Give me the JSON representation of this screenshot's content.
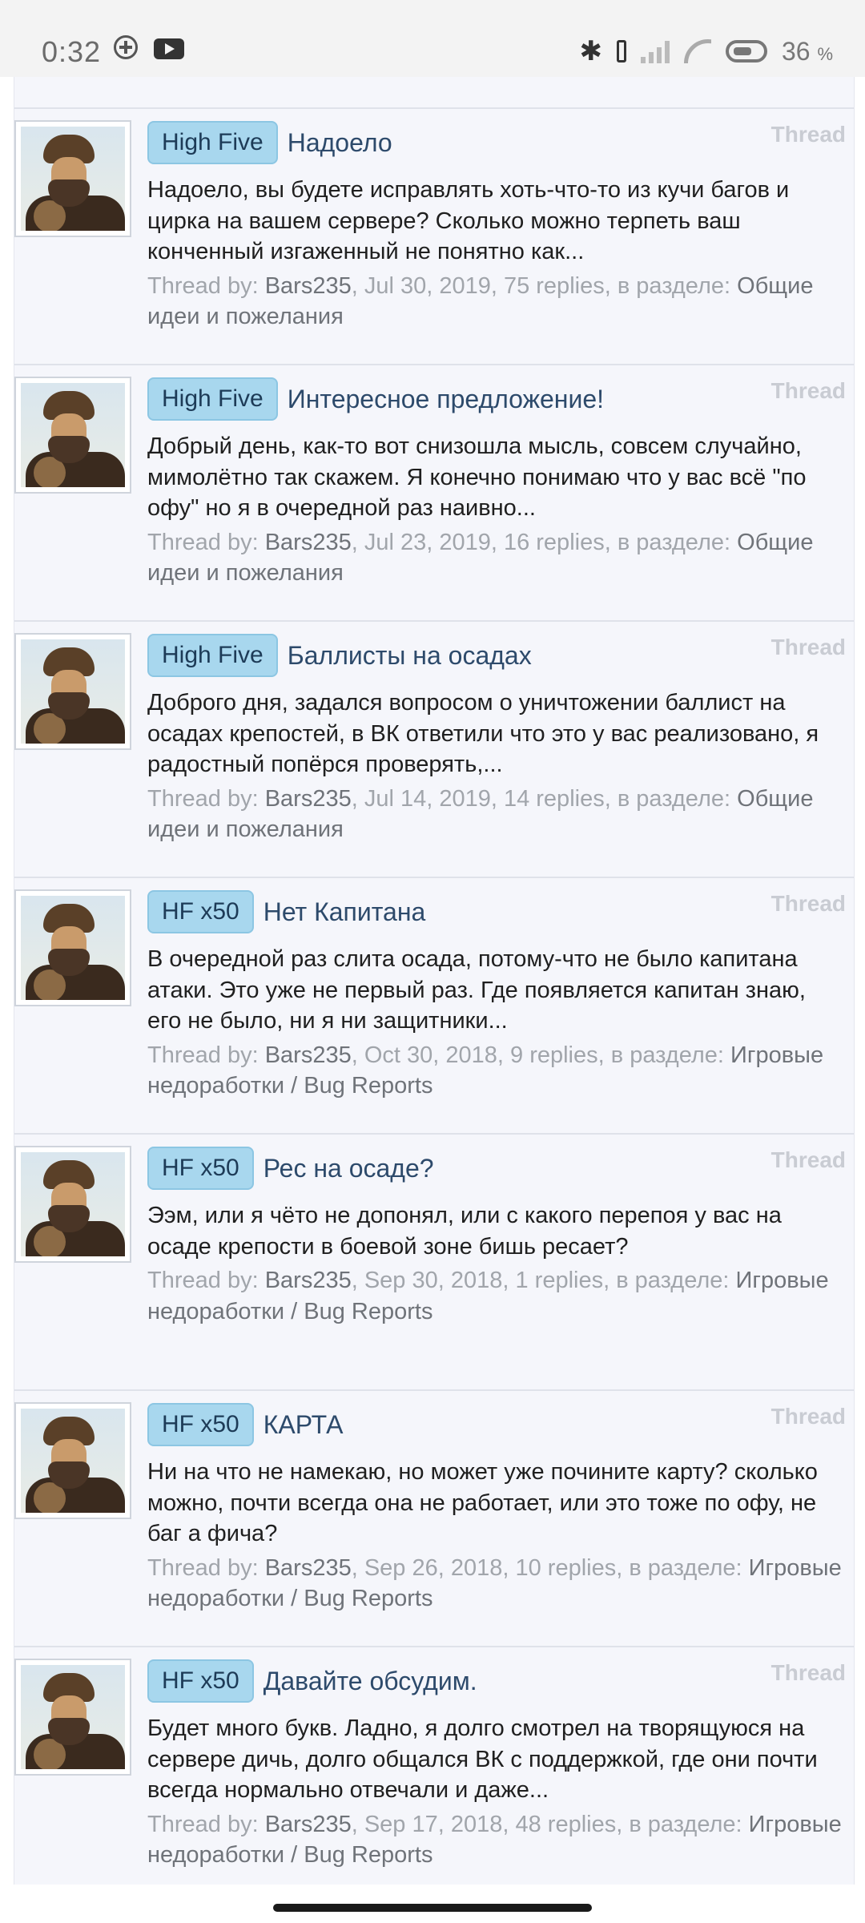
{
  "status_bar": {
    "time": "0:32",
    "battery_percent": "36",
    "battery_unit": "%",
    "icons": [
      "add-circle-icon",
      "youtube-icon",
      "bluetooth-icon",
      "vibrate-icon",
      "signal-icon",
      "wifi-icon",
      "battery-icon"
    ]
  },
  "threads": [
    {
      "prefix": "High Five",
      "title": "Надоело",
      "badge": "Thread",
      "snippet": "Надоело, вы будете исправлять хоть-что-то из кучи багов и цирка на вашем сервере? Сколько можно терпеть ваш конченный изгаженный не понятно как...",
      "meta_label": "Thread by:",
      "author": "Bars235",
      "details": ", Jul 30, 2019, 75 replies, в разделе:",
      "section": "Общие идеи и пожелания"
    },
    {
      "prefix": "High Five",
      "title": "Интересное предложение!",
      "badge": "Thread",
      "snippet": "Добрый день, как-то вот снизошла мысль, совсем случайно, мимолётно так скажем. Я конечно понимаю что у вас всё \"по офу\" но я в очередной раз наивно...",
      "meta_label": "Thread by:",
      "author": "Bars235",
      "details": ", Jul 23, 2019, 16 replies, в разделе:",
      "section": "Общие идеи и пожелания"
    },
    {
      "prefix": "High Five",
      "title": "Баллисты на осадах",
      "badge": "Thread",
      "snippet": "Доброго дня, задался вопросом о уничтожении баллист на осадах крепостей, в ВК ответили что это у вас реализовано, я радостный попёрся проверять,...",
      "meta_label": "Thread by:",
      "author": "Bars235",
      "details": ", Jul 14, 2019, 14 replies, в разделе:",
      "section": "Общие идеи и пожелания"
    },
    {
      "prefix": "HF x50",
      "title": "Нет Капитана",
      "badge": "Thread",
      "snippet": "В очередной раз слита осада, потому-что не было капитана атаки. Это уже не первый раз. Где появляется капитан знаю, его не было, ни я ни защитники...",
      "meta_label": "Thread by:",
      "author": "Bars235",
      "details": ", Oct 30, 2018, 9 replies, в разделе:",
      "section": "Игровые недоработки / Bug Reports"
    },
    {
      "prefix": "HF x50",
      "title": "Рес на осаде?",
      "badge": "Thread",
      "snippet": "Ээм, или я чёто не допонял, или с какого перепоя у вас на осаде крепости в боевой зоне бишь ресает?",
      "meta_label": "Thread by:",
      "author": "Bars235",
      "details": ", Sep 30, 2018, 1 replies, в разделе:",
      "section": "Игровые недоработки / Bug Reports"
    },
    {
      "prefix": "HF x50",
      "title": "КАРТА",
      "badge": "Thread",
      "snippet": "Ни на что не намекаю, но может уже почините карту? сколько можно, почти всегда она не работает, или это тоже по офу, не баг а фича?",
      "meta_label": "Thread by:",
      "author": "Bars235",
      "details": ", Sep 26, 2018, 10 replies, в разделе:",
      "section": "Игровые недоработки / Bug Reports"
    },
    {
      "prefix": "HF x50",
      "title": "Давайте обсудим.",
      "badge": "Thread",
      "snippet": "Будет много букв. Ладно, я долго смотрел на творящуюся на сервере дичь, долго общался ВК с поддержкой, где они почти всегда нормально отвечали и даже...",
      "meta_label": "Thread by:",
      "author": "Bars235",
      "details": ", Sep 17, 2018, 48 replies, в разделе:",
      "section": "Игровые недоработки / Bug Reports"
    }
  ]
}
